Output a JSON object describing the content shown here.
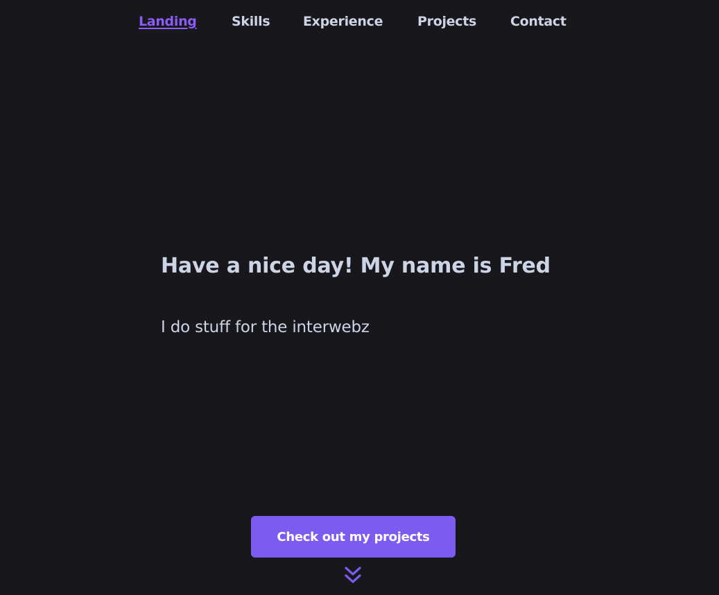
{
  "nav": {
    "items": [
      {
        "label": "Landing",
        "active": true
      },
      {
        "label": "Skills",
        "active": false
      },
      {
        "label": "Experience",
        "active": false
      },
      {
        "label": "Projects",
        "active": false
      },
      {
        "label": "Contact",
        "active": false
      }
    ]
  },
  "hero": {
    "title": "Have a nice day! My name is Fred",
    "subtitle": "I do stuff for the interwebz"
  },
  "cta": {
    "label": "Check out my projects"
  },
  "icons": {
    "scroll": "double-chevron-down-icon"
  },
  "colors": {
    "background": "#18171c",
    "text": "#cdd4e6",
    "accent": "#7c5cf0",
    "active_link": "#8b5cf6"
  }
}
